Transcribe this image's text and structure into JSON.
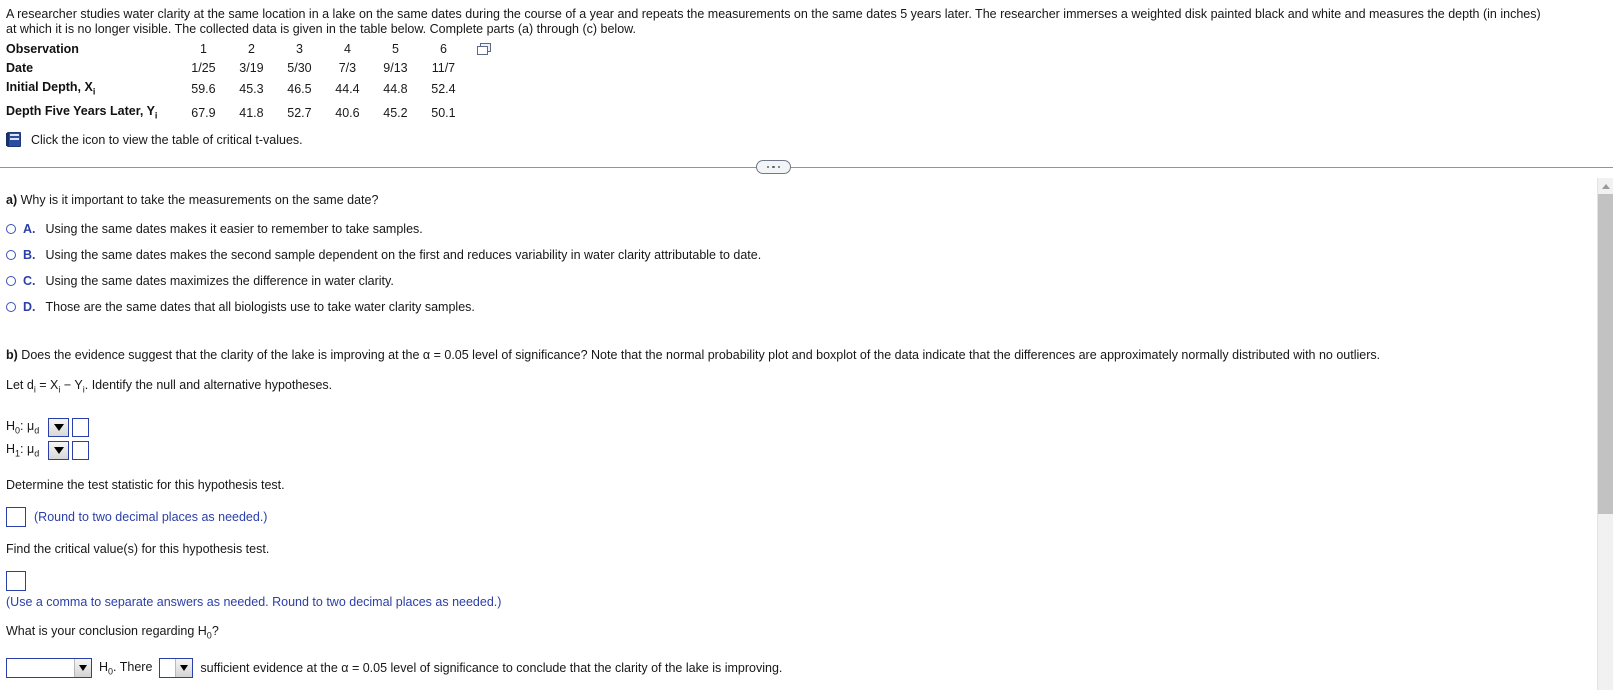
{
  "problem": {
    "stem_line1": "A researcher studies water clarity at the same location in a lake on the same dates during the course of a year and repeats the measurements on the same dates 5 years later. The researcher immerses a weighted disk painted black and white and measures the depth (in inches)",
    "stem_line2": "at which it is no longer visible. The collected data is given in the table below. Complete parts (a) through (c) below.",
    "table": {
      "rows": [
        {
          "label": "Observation",
          "values": [
            "1",
            "2",
            "3",
            "4",
            "5",
            "6"
          ]
        },
        {
          "label": "Date",
          "values": [
            "1/25",
            "3/19",
            "5/30",
            "7/3",
            "9/13",
            "11/7"
          ]
        },
        {
          "label_html": "Initial Depth, X",
          "label_sub": "i",
          "values": [
            "59.6",
            "45.3",
            "46.5",
            "44.4",
            "44.8",
            "52.4"
          ]
        },
        {
          "label_html": "Depth Five Years Later, Y",
          "label_sub": "i",
          "values": [
            "67.9",
            "41.8",
            "52.7",
            "40.6",
            "45.2",
            "50.1"
          ]
        }
      ]
    },
    "critical_values_link": "Click the icon to view the table of critical t-values."
  },
  "part_a": {
    "label": "a)",
    "question": "Why is it important to take the measurements on the same date?",
    "choices": [
      {
        "letter": "A.",
        "text": "Using the same dates makes it easier to remember to take samples."
      },
      {
        "letter": "B.",
        "text": "Using the same dates makes the second sample dependent on the first and reduces variability in water clarity attributable to date."
      },
      {
        "letter": "C.",
        "text": "Using the same dates maximizes the difference in water clarity."
      },
      {
        "letter": "D.",
        "text": "Those are the same dates that all biologists use to take water clarity samples."
      }
    ]
  },
  "part_b": {
    "label": "b)",
    "question": "Does the evidence suggest that the clarity of the lake is improving at the α = 0.05 level of significance? Note that the normal probability plot and boxplot of the data indicate that the differences are approximately normally distributed with no outliers.",
    "let_line_pre": "Let d",
    "let_line_sub1": "i",
    "let_line_mid": " = X",
    "let_line_sub2": "i",
    "let_line_minus": " − Y",
    "let_line_sub3": "i",
    "let_line_post": ". Identify the null and alternative hypotheses.",
    "h0_label_h": "H",
    "h0_label_sub": "0",
    "h0_label_mu": ": μ",
    "h0_label_mu_sub": "d",
    "h1_label_h": "H",
    "h1_label_sub": "1",
    "h1_label_mu": ": μ",
    "h1_label_mu_sub": "d",
    "h0_operator_value": "",
    "h0_value": "",
    "h1_operator_value": "",
    "h1_value": "",
    "test_statistic_prompt": "Determine the test statistic for this hypothesis test.",
    "test_statistic_value": "",
    "test_statistic_hint": "(Round to two decimal places as needed.)",
    "critical_value_prompt": "Find the critical value(s) for this hypothesis test.",
    "critical_value_value": "",
    "critical_value_hint": "(Use a comma to separate answers as needed. Round to two decimal places as needed.)",
    "conclusion_prompt_pre": "What is your conclusion regarding H",
    "conclusion_prompt_sub": "0",
    "conclusion_prompt_post": "?",
    "conclusion_select1_value": "",
    "conclusion_mid_pre": "H",
    "conclusion_mid_sub": "0",
    "conclusion_mid_post": ". There",
    "conclusion_select2_value": "",
    "conclusion_tail": "sufficient evidence at the α = 0.05 level of significance to conclude that the clarity of the lake is improving."
  },
  "icons": {
    "spreadsheet": "spreadsheet-copy-icon",
    "book": "book-icon",
    "dots": "expand-dots-icon"
  },
  "colors": {
    "accent_blue": "#2b3fa8",
    "text": "#171717",
    "divider": "#8c94a5",
    "scrollbar_thumb": "#c2c2c2"
  }
}
